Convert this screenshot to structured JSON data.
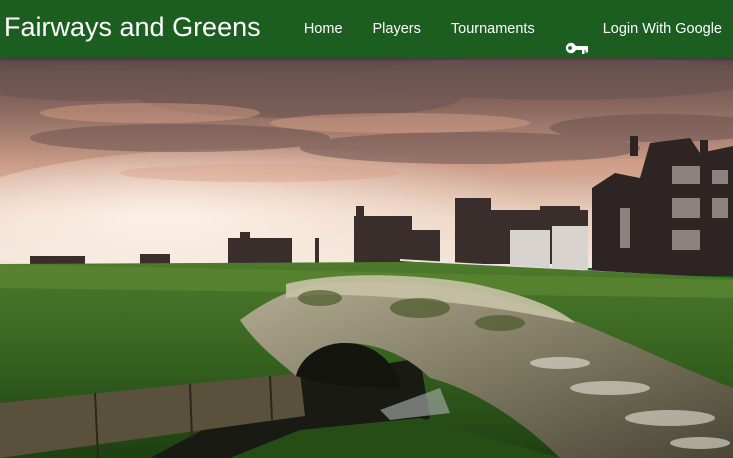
{
  "app": {
    "brand": "Fairways and Greens"
  },
  "nav": {
    "items": [
      {
        "label": "Home"
      },
      {
        "label": "Players"
      },
      {
        "label": "Tournaments"
      }
    ],
    "login": {
      "label": "Login With Google",
      "icon": "key-icon"
    }
  },
  "theme": {
    "navbar_color": "#1b5e20",
    "text_color": "#ffffff"
  },
  "hero": {
    "icon": "golf-course-bridge-image"
  }
}
